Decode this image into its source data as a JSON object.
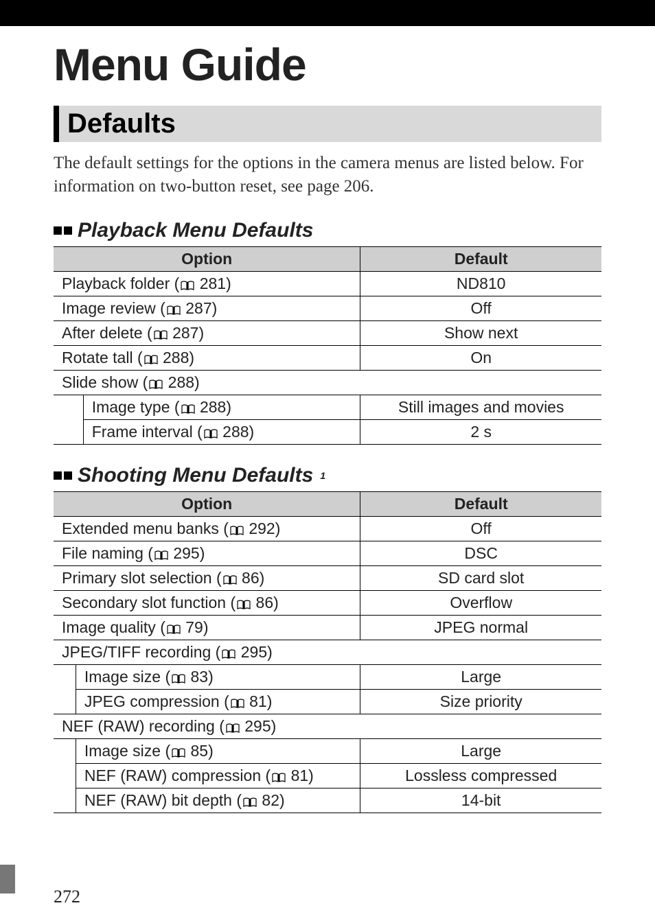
{
  "page_title": "Menu Guide",
  "section_heading": "Defaults",
  "intro_text": "The default settings for the options in the camera menus are listed below.  For information on two-button reset, see page 206.",
  "playback_table": {
    "heading": "Playback Menu Defaults",
    "columns": {
      "option": "Option",
      "default": "Default"
    },
    "rows": [
      {
        "type": "row",
        "label": "Playback folder",
        "page": "281",
        "default": "ND810"
      },
      {
        "type": "row",
        "label": "Image review",
        "page": "287",
        "default": "Off"
      },
      {
        "type": "row",
        "label": "After delete",
        "page": "287",
        "default": "Show next"
      },
      {
        "type": "row",
        "label": "Rotate tall",
        "page": "288",
        "default": "On"
      },
      {
        "type": "group",
        "label": "Slide show",
        "page": "288"
      },
      {
        "type": "sub",
        "label": "Image type",
        "page": "288",
        "default": "Still images and movies"
      },
      {
        "type": "sub",
        "label": "Frame interval",
        "page": "288",
        "default": "2 s",
        "last": true
      }
    ]
  },
  "shooting_table": {
    "heading": "Shooting Menu Defaults",
    "footnote_marker": "1",
    "columns": {
      "option": "Option",
      "default": "Default"
    },
    "rows": [
      {
        "type": "row",
        "label": "Extended menu banks",
        "page": "292",
        "default": "Off"
      },
      {
        "type": "row",
        "label": "File naming",
        "page": "295",
        "default": "DSC"
      },
      {
        "type": "row",
        "label": "Primary slot selection",
        "page": "86",
        "default": "SD card slot"
      },
      {
        "type": "row",
        "label": "Secondary slot function",
        "page": "86",
        "default": "Overflow"
      },
      {
        "type": "row",
        "label": "Image quality",
        "page": "79",
        "default": "JPEG normal"
      },
      {
        "type": "group",
        "label": "JPEG/TIFF recording",
        "page": "295"
      },
      {
        "type": "sub",
        "label": "Image size",
        "page": "83",
        "default": "Large"
      },
      {
        "type": "sub",
        "label": "JPEG compression",
        "page": "81",
        "default": "Size priority",
        "last": true
      },
      {
        "type": "group",
        "label": "NEF (RAW) recording",
        "page": "295"
      },
      {
        "type": "sub",
        "label": "Image size",
        "page": "85",
        "default": "Large"
      },
      {
        "type": "sub",
        "label": "NEF (RAW) compression",
        "page": "81",
        "default": "Lossless compressed"
      },
      {
        "type": "sub",
        "label": "NEF (RAW) bit depth",
        "page": "82",
        "default": "14-bit",
        "last": true
      }
    ]
  },
  "page_number": "272"
}
